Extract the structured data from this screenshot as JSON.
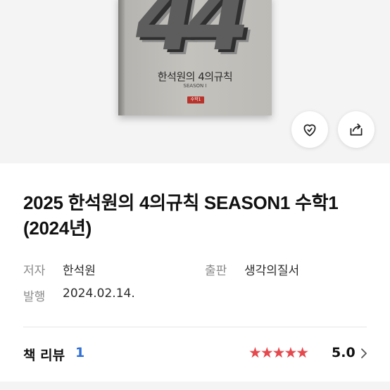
{
  "cover": {
    "art_text": "44",
    "title": "한석원의 4의규칙",
    "season": "SEASON I",
    "badge": "수학1"
  },
  "actions": {
    "wishlist_icon": "heart-outline-icon",
    "share_icon": "share-icon"
  },
  "book": {
    "title": "2025 한석원의 4의규칙 SEASON1 수학1 (2024년)",
    "author_label": "저자",
    "author": "한석원",
    "publisher_label": "출판",
    "publisher": "생각의질서",
    "published_label": "발행",
    "published": "2024.02.14."
  },
  "review": {
    "label": "책 리뷰",
    "count": "1",
    "stars": "★★★★★",
    "rating": "5.0",
    "star_color": "#e5484d",
    "count_color": "#2f6fd6"
  }
}
